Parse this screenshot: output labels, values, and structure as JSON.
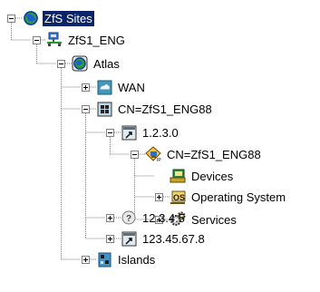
{
  "tree": {
    "root": {
      "label": "ZfS Sites",
      "icon": "globe-icon",
      "selected": true,
      "expanded": true
    },
    "nodes": [
      {
        "id": "zfs1-eng",
        "label": "ZfS1_ENG",
        "icon": "server-network-icon",
        "expanded": true
      },
      {
        "id": "atlas",
        "label": "Atlas",
        "icon": "atlas-globe-icon",
        "expanded": true
      },
      {
        "id": "wan",
        "label": "WAN",
        "icon": "wan-cloud-icon",
        "expanded": false
      },
      {
        "id": "cn-zfs1-eng88",
        "label": "CN=ZfS1_ENG88",
        "icon": "container-icon",
        "expanded": true
      },
      {
        "id": "ip-1230",
        "label": "1.2.3.0",
        "icon": "subnet-icon",
        "expanded": true
      },
      {
        "id": "cn-zfs1-eng88-ip",
        "label": "CN=ZfS1_ENG88",
        "icon": "ip-host-icon",
        "expanded": true
      },
      {
        "id": "devices",
        "label": "Devices",
        "icon": "devices-icon"
      },
      {
        "id": "os",
        "label": "Operating System",
        "icon": "operating-system-icon",
        "expanded": false
      },
      {
        "id": "services",
        "label": "Services",
        "icon": "services-gear-icon",
        "expanded": false
      },
      {
        "id": "ip-12345",
        "label": "12.3.4.5",
        "icon": "unknown-subnet-icon",
        "expanded": false
      },
      {
        "id": "ip-12345678",
        "label": "123.45.67.8",
        "icon": "subnet-icon",
        "expanded": false
      },
      {
        "id": "islands",
        "label": "Islands",
        "icon": "islands-icon",
        "expanded": false
      }
    ]
  }
}
